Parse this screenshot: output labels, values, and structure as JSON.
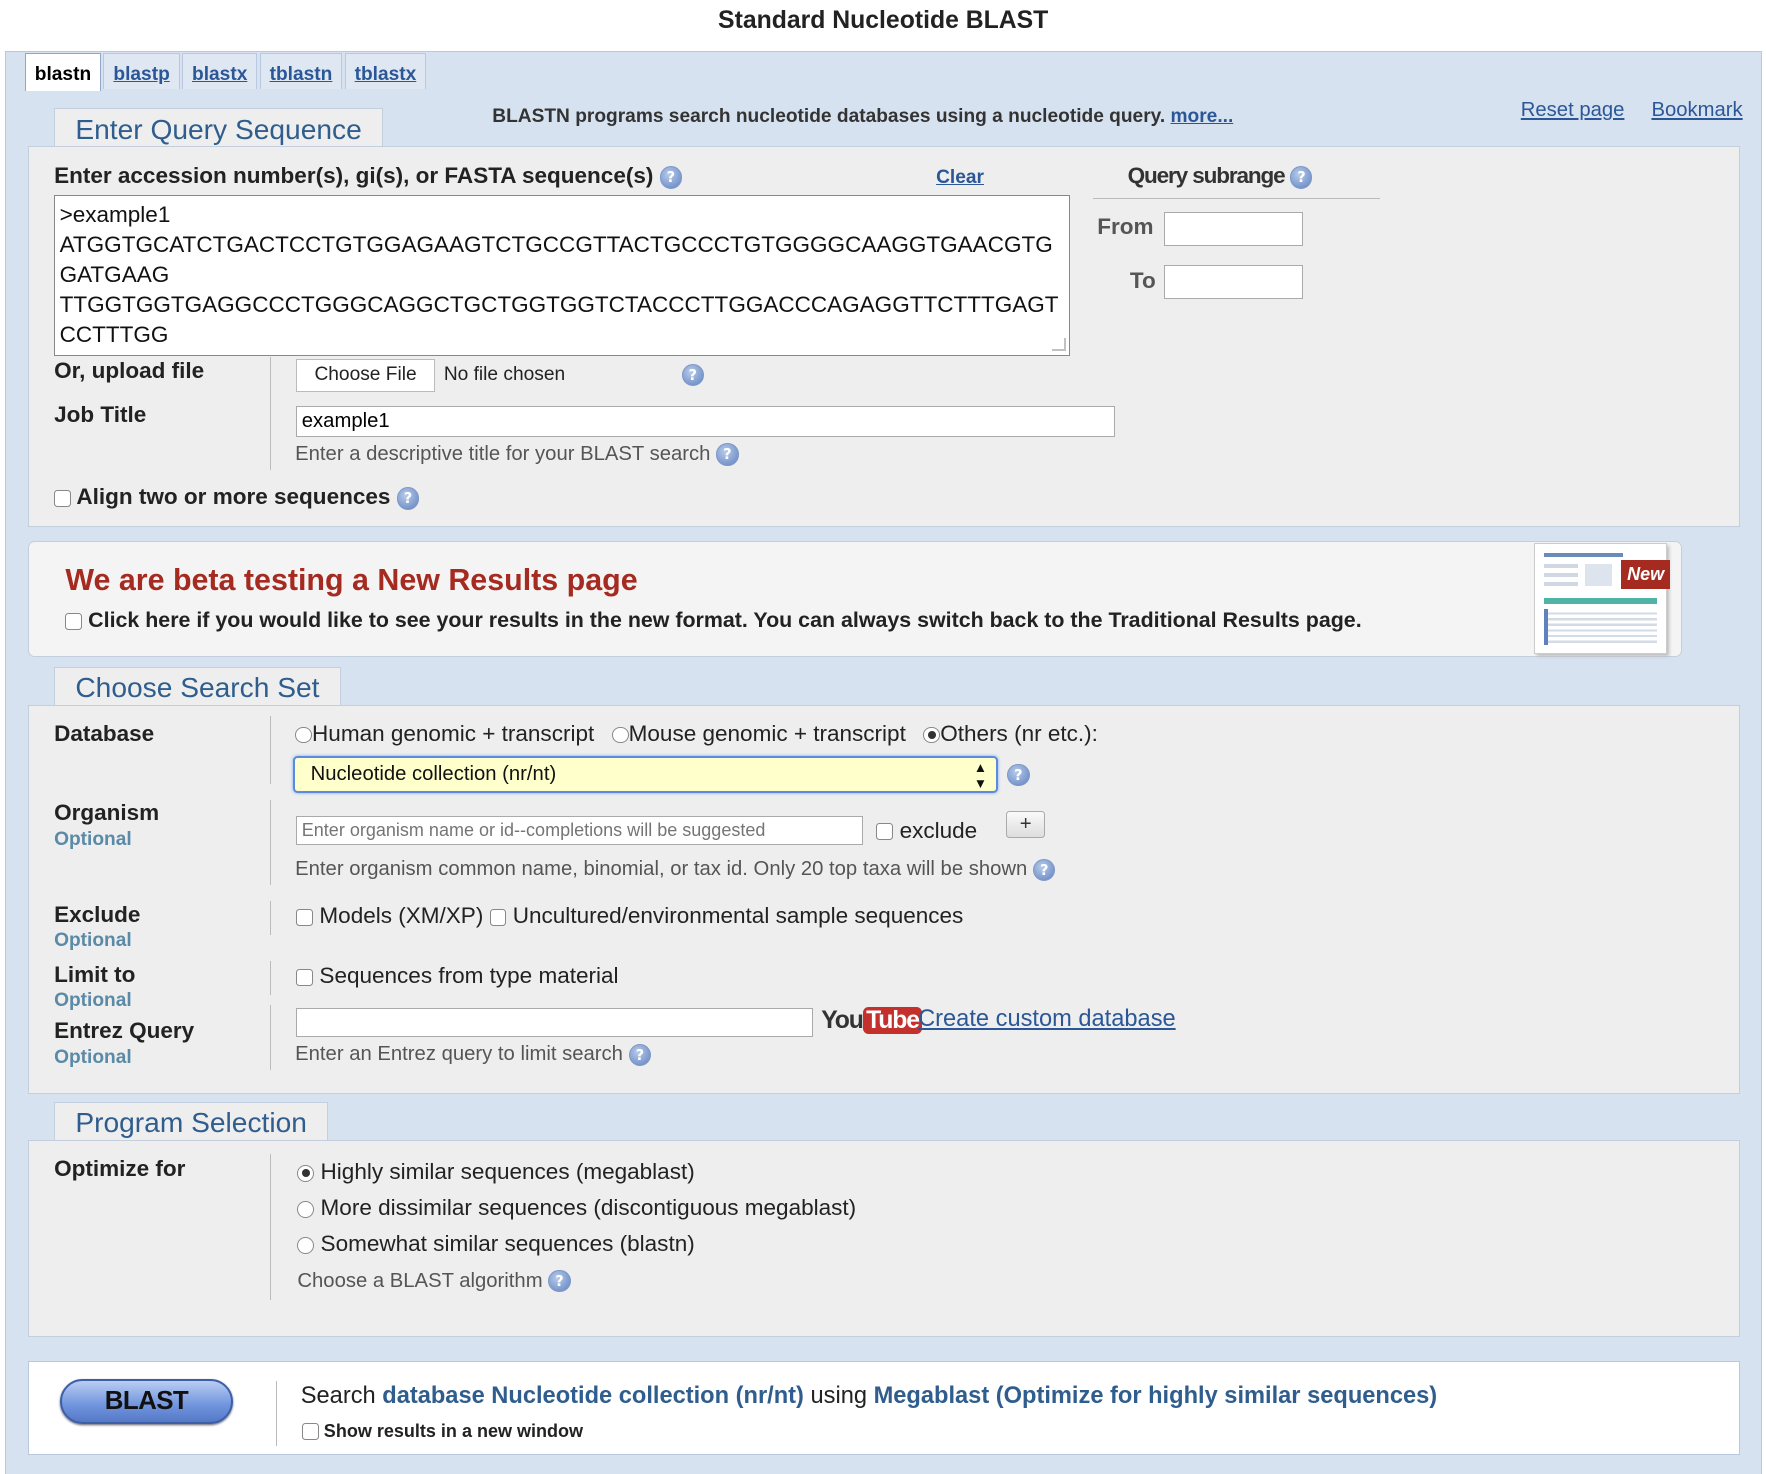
{
  "page_title": "Standard Nucleotide BLAST",
  "tabs": [
    {
      "label": "blastn"
    },
    {
      "label": "blastp"
    },
    {
      "label": "blastx"
    },
    {
      "label": "tblastn"
    },
    {
      "label": "tblastx"
    }
  ],
  "header": {
    "description": "BLASTN programs search nucleotide databases using a nucleotide query.",
    "more_link": "more...",
    "reset_link": "Reset page",
    "bookmark_link": "Bookmark"
  },
  "query": {
    "legend": "Enter Query Sequence",
    "label": "Enter accession number(s), gi(s), or FASTA sequence(s)",
    "clear_link": "Clear",
    "sequence": ">example1\nATGGTGCATCTGACTCCTGTGGAGAAGTCTGCCGTTACTGCCCTGTGGGGCAAGGTGAACGTGGATGAAG\nTTGGTGGTGAGGCCCTGGGCAGGCTGCTGGTGGTCTACCCTTGGACCCAGAGGTTCTTTGAGTCCTTTGG",
    "subrange_title": "Query subrange",
    "from_label": "From",
    "to_label": "To",
    "from_value": "",
    "to_value": "",
    "upload_label": "Or, upload file",
    "choose_file_label": "Choose File",
    "no_file_text": "No file chosen",
    "job_title_label": "Job Title",
    "job_title_value": "example1",
    "job_title_hint": "Enter a descriptive title for your BLAST search",
    "align_label": "Align two or more sequences"
  },
  "beta": {
    "heading": "We are beta testing a New Results page",
    "checkbox_label": "Click here if you would like to see your results in the new format. You can always switch back to the Traditional Results page.",
    "new_badge": "New"
  },
  "search_set": {
    "legend": "Choose Search Set",
    "database_label": "Database",
    "db_options": [
      {
        "label": "Human genomic + transcript",
        "selected": false
      },
      {
        "label": "Mouse genomic + transcript",
        "selected": false
      },
      {
        "label": "Others (nr etc.):",
        "selected": true
      }
    ],
    "db_select_value": "Nucleotide collection (nr/nt)",
    "organism_label": "Organism",
    "optional": "Optional",
    "organism_placeholder": "Enter organism name or id--completions will be suggested",
    "exclude_checkbox": "exclude",
    "add_button": "+",
    "organism_hint": "Enter organism common name, binomial, or tax id. Only 20 top taxa will be shown",
    "exclude_label": "Exclude",
    "exclude_models": "Models (XM/XP)",
    "exclude_uncultured": "Uncultured/environmental sample sequences",
    "limit_label": "Limit to",
    "limit_type_material": "Sequences from type material",
    "entrez_label": "Entrez Query",
    "entrez_value": "",
    "youtube_you": "You",
    "youtube_tube": "Tube",
    "custom_db_link": "Create custom database",
    "entrez_hint": "Enter an Entrez query to limit search"
  },
  "program": {
    "legend": "Program Selection",
    "optimize_label": "Optimize for",
    "options": [
      {
        "label": "Highly similar sequences (megablast)",
        "selected": true
      },
      {
        "label": "More dissimilar sequences (discontiguous megablast)",
        "selected": false
      },
      {
        "label": "Somewhat similar sequences (blastn)",
        "selected": false
      }
    ],
    "hint": "Choose a BLAST algorithm"
  },
  "submit": {
    "button_label": "BLAST",
    "search_prefix": "Search",
    "search_db": "database Nucleotide collection (nr/nt)",
    "search_using": "using",
    "search_program": "Megablast (Optimize for highly similar sequences)",
    "new_window_label": "Show results in a new window"
  },
  "colors": {
    "accent_blue": "#2b5797",
    "heading_red": "#a52a20",
    "select_highlight": "#ffffcc"
  }
}
